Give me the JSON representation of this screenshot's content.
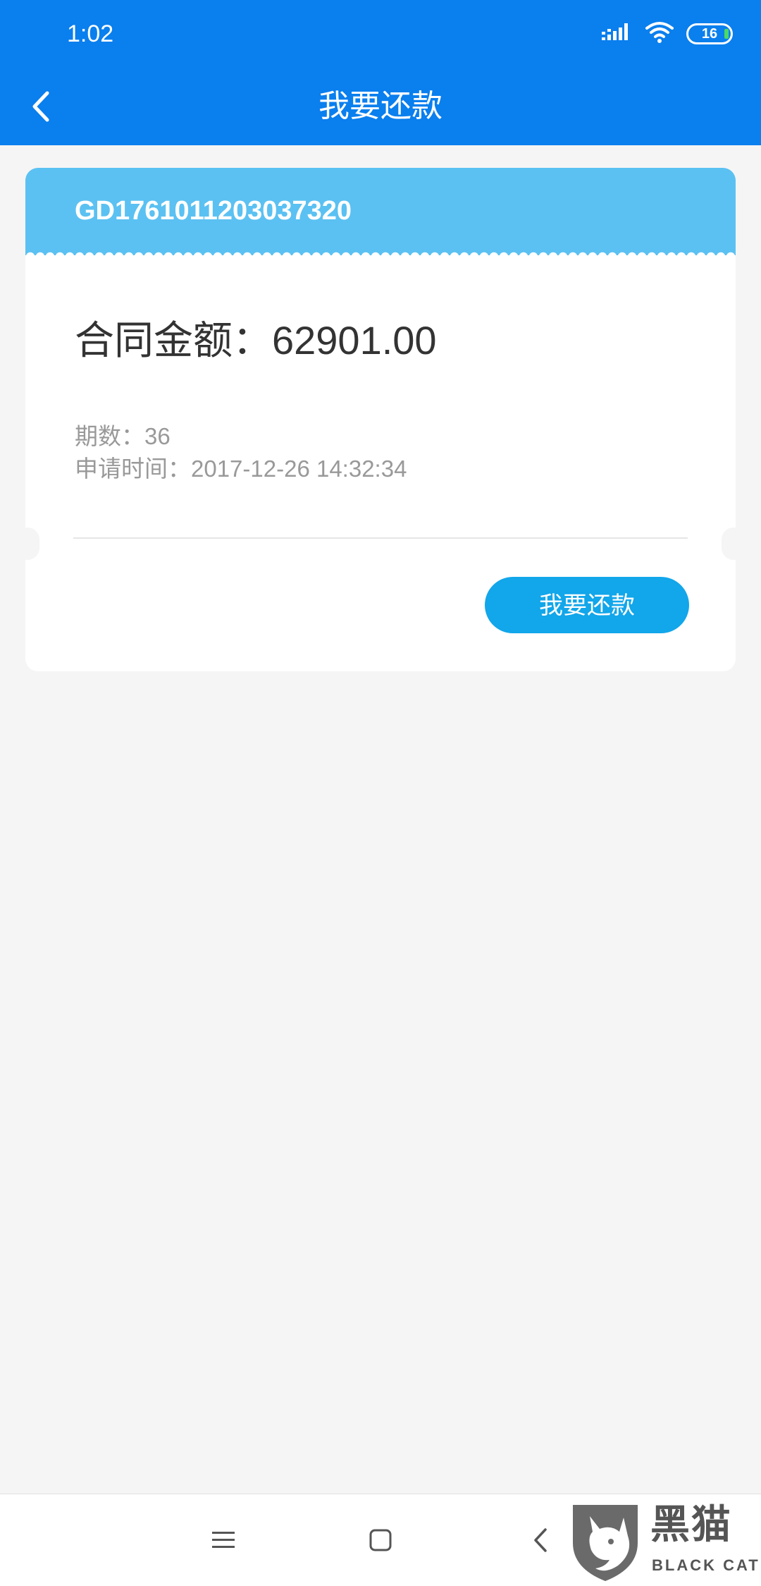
{
  "status_bar": {
    "time": "1:02",
    "battery_level": "16",
    "icons": [
      "signal-icon",
      "wifi-icon",
      "battery-icon"
    ]
  },
  "nav": {
    "title": "我要还款",
    "back_icon": "chevron-left-icon"
  },
  "contract": {
    "order_no": "GD1761011203037320",
    "amount_label": "合同金额：",
    "amount_value": "62901.00",
    "periods_label": "期数：",
    "periods_value": "36",
    "apply_time_label": "申请时间：",
    "apply_time_value": "2017-12-26 14:32:34",
    "repay_button_label": "我要还款"
  },
  "system_nav": {
    "icons": [
      "menu-icon",
      "home-icon",
      "back-icon"
    ]
  },
  "watermark": {
    "text_cn": "黑猫",
    "text_en": "BLACK CAT"
  },
  "colors": {
    "header": "#0a7fee",
    "card_top": "#5bc1f2",
    "button": "#12a6ea",
    "background": "#f5f5f5"
  }
}
